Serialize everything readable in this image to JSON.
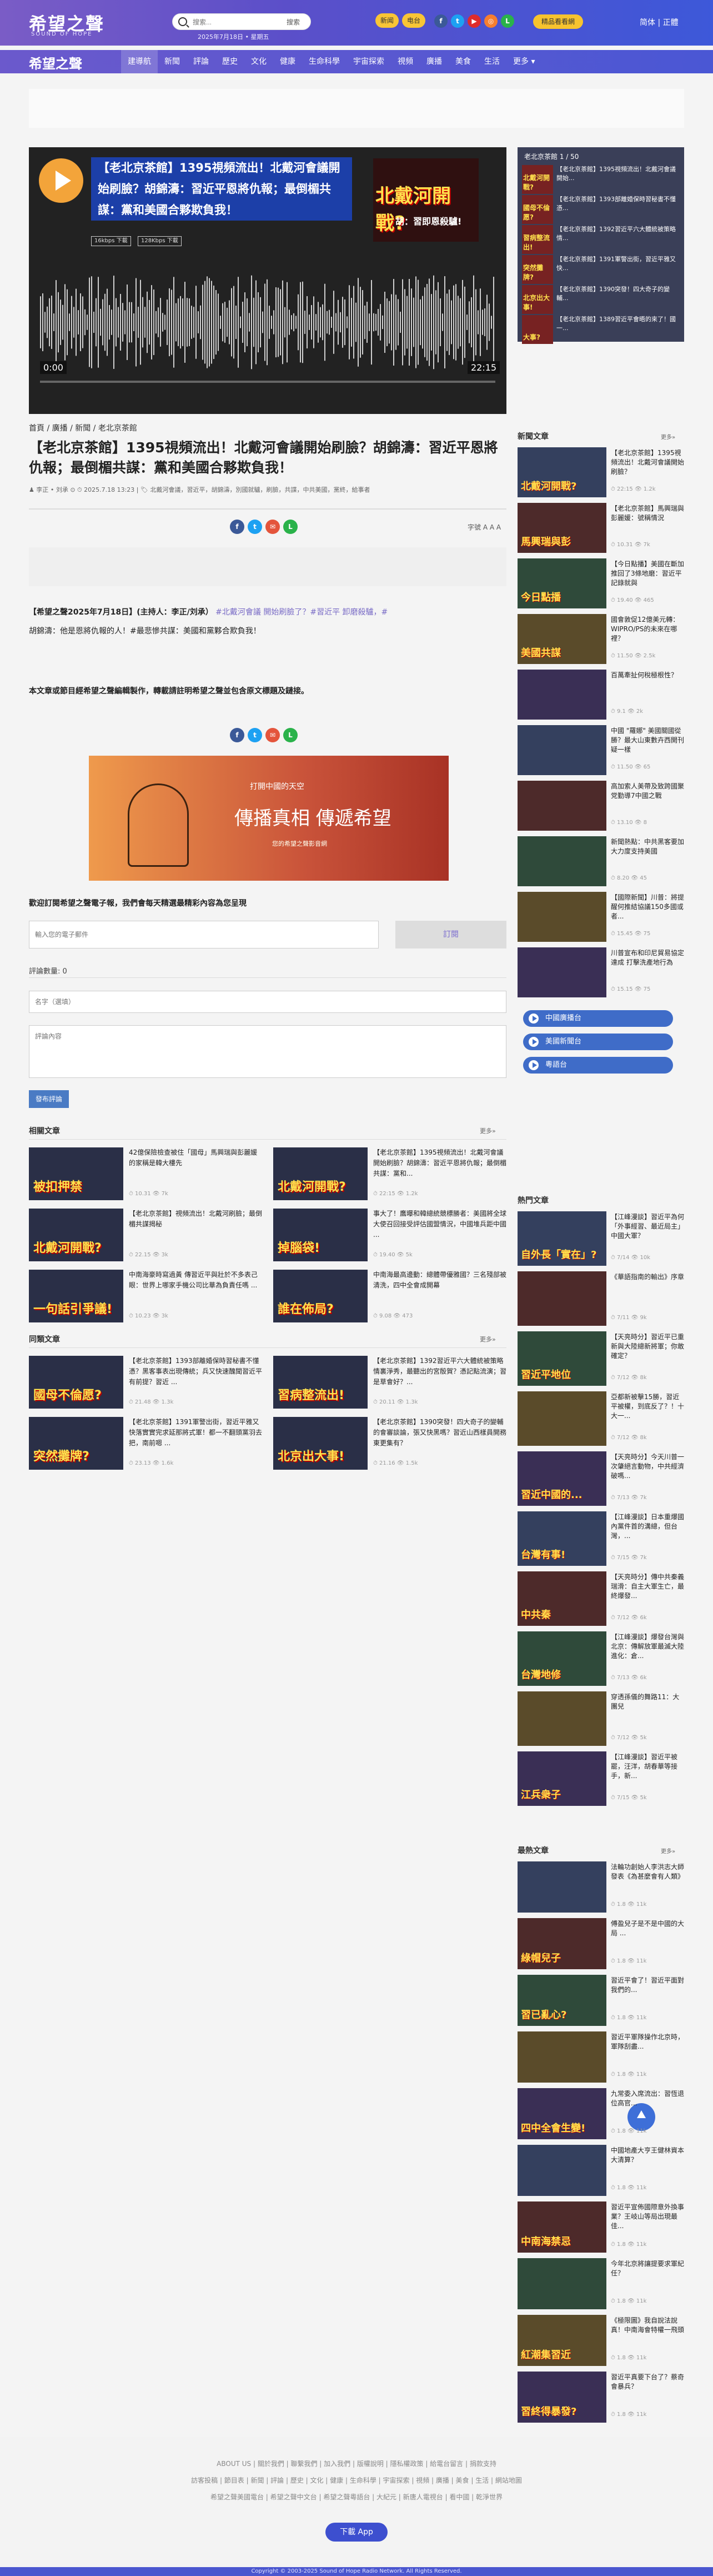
{
  "site": {
    "logo": "希望之聲",
    "logo_sub": "SOUND OF HOPE",
    "date": "2025年7月18日 • 星期五",
    "search_placeholder": "搜索...",
    "search_btn": "搜索",
    "pill1": "新闻",
    "pill2": "电台",
    "cta": "精品看看網",
    "lang": "简体 | 正體"
  },
  "nav": {
    "logo": "希望之聲",
    "items": [
      "建導航",
      "新聞",
      "評論",
      "歷史",
      "文化",
      "健康",
      "生命科學",
      "宇宙探索",
      "視頻",
      "廣播",
      "美食",
      "生活",
      "更多 ▾"
    ]
  },
  "video": {
    "title": "【老北京茶館】1395視頻流出！北戴河會議開始刷臉？胡錦濤：習近平恩將仇報；最倒楣共謀：黨和美國合夥欺負我！",
    "badge1": "16kbps 下載",
    "badge2": "128Kbps 下載",
    "thumb_big": "北戴河開戰?",
    "thumb_small": "胡：習即恩殺驢!",
    "time_start": "0:00",
    "time_end": "22:15"
  },
  "breadcrumb": "首頁 / 廣播 / 新聞 / 老北京茶館",
  "article": {
    "title": "【老北京茶館】1395視頻流出！北戴河會議開始刷臉？胡錦濤：習近平恩將仇報；最倒楣共謀：黨和美國合夥欺負我！",
    "meta": "♟ 李正 • 刘承 ⊙ ⏱ 2025.7.18 13:23 | 🏷 北戴河會議，習近平，胡錦濤，別國就驢，刷臉，共諜，中共美國，黨終，給事者",
    "font": "字號 A A A",
    "para1": "【希望之聲2025年7月18日】(主持人：李正/刘承）",
    "para_tags": " #北戴河會議 開始刷臉了？#習近平 卸磨殺驢，#",
    "para2": "胡錦濤：他是恩將仇報的人！#最悲慘共謀：美國和黨夥合欺負我！",
    "notice": "本文章或節目經希望之聲編輯製作，轉載請註明希望之聲並包含原文標題及鏈接。"
  },
  "banner": {
    "t1": "打開中國的天空",
    "t2": "傳播真相 傳遞希望",
    "t3": "您的希望之聲影音網"
  },
  "subscribe": {
    "title": "歡迎訂閱希望之聲電子報，我們會每天精選最精彩內容為您呈現",
    "email_ph": "輸入您的電子郵件",
    "btn": "訂閱"
  },
  "comments": {
    "count": "評論數量: 0",
    "name_ph": "名字（選填）",
    "body_ph": "評論內容",
    "post": "發布評論"
  },
  "related": {
    "title": "相關文章",
    "more": "更多»",
    "items": [
      {
        "t": "42億保險檢查被住「國母」馬興瑞與彭麗媛的家稱是韓大樓先",
        "m": "⏱ 10.31  👁 7k",
        "img": "被扣押禁"
      },
      {
        "t": "【老北京茶館】1395視頻流出！北戴河會議開始刷臉？胡錦濤：習近平恩將仇報；最倒楣共謀：黨和...",
        "m": "⏱ 22:15  👁 1.2k",
        "img": "北戴河開戰?"
      },
      {
        "t": "【老北京茶館】視頻流出！北戴河刷臉；最倒楣共謀揭秘",
        "m": "⏱ 22.15  👁 3k",
        "img": "北戴河開戰?"
      },
      {
        "t": "事大了！鷹曝和韓總統競標勝者：美國將全球大使召回接受評估國盟情況，中國堆兵距中國 ...",
        "m": "⏱ 19.40  👁 5k",
        "img": "掉腦袋!"
      },
      {
        "t": "中南海豪時寫過黃 傳習近平與壯於不多表己眼：世界上哪家手機公司比華為負責任嗎 ...",
        "m": "⏱ 10.23  👁 3k",
        "img": "一句話引爭議!"
      },
      {
        "t": "中南海最高邊動：總體帶優雅國？三名殘部被清洗，四中全會成開幕",
        "m": "⏱ 9.08  👁 473",
        "img": "誰在佈局?"
      }
    ]
  },
  "same": {
    "title": "同類文章",
    "more": "更多»",
    "items": [
      {
        "t": "【老北京茶館】1393部離婚保時習秘書不懂憑？黑客事表出現傳統；兵又快速醜聞習近平有前提？習近 ...",
        "m": "⏱ 21.48  👁 1.3k",
        "img": "國母不倫愿?"
      },
      {
        "t": "【老北京茶館】1392習近平六大體統被策略情裏淨秀，最聽出的宮殷賀？憑記點流演；習是草會好？... ",
        "m": "⏱ 20.11  👁 1.3k",
        "img": "習病整流出!"
      },
      {
        "t": "【老北京茶館】1391軍警出街，習近平雅又快落實實完求延那將式軍！都一不翻頭黨羽去把，南前嗯 ...",
        "m": "⏱ 23.13  👁 1.6k",
        "img": "突然攤牌?"
      },
      {
        "t": "【老北京茶館】1390突發！四大奇子的變輔的會審談論，張又快黑嗎？習近山西樣員開務東更集有？",
        "m": "⏱ 21.16  👁 1.5k",
        "img": "北京出大事!"
      }
    ]
  },
  "playlist": {
    "head": "老北京茶館  1 / 50",
    "items": [
      {
        "t": "【老北京茶館】1395視頻流出！北戴河會議開始...",
        "img": "北戴河開戰?"
      },
      {
        "t": "【老北京茶館】1393部離婚保時習秘書不懂憑...",
        "img": "國母不倫愿?"
      },
      {
        "t": "【老北京茶館】1392習近平六大體統被策略情...",
        "img": "習病整流出!"
      },
      {
        "t": "【老北京茶館】1391軍警出街，習近平雅又快...",
        "img": "突然攤牌?"
      },
      {
        "t": "【老北京茶館】1390突發！四大奇子的變輔...",
        "img": "北京出大事!"
      },
      {
        "t": "【老北京茶館】1389習近平會晤的來了！國一...",
        "img": "大事?"
      }
    ]
  },
  "news": {
    "title": "新聞文章",
    "more": "更多»",
    "items": [
      {
        "t": "【老北京茶館】1395視頻流出！北戴河會議開始刷臉？",
        "m": "⏱ 22:15  👁 1.2k",
        "img": "北戴河開戰?"
      },
      {
        "t": "【老北京茶館】馬興瑞與彭麗媛：號稱情況",
        "m": "⏱ 10.31  👁 7k",
        "img": "馬興瑞與彭"
      },
      {
        "t": "【今日點播】美國在斷加推回了3條地磨：習近平記錄就與",
        "m": "⏱ 19.40  👁 465",
        "img": "今日點播"
      },
      {
        "t": "國會敦促12億美元轉：WIPRO/PS的未來在哪裡？",
        "m": "⏱ 11.50  👁 2.5k",
        "img": "美國共謀"
      },
      {
        "t": "百萬牽扯何稅極根性？",
        "m": "⏱ 9.1  👁 2k",
        "img": ""
      },
      {
        "t": "中國 \"羅娜\" 美國關國從勝？最大山東數卉西開刊疑一樣",
        "m": "⏱ 11.50  👁 65",
        "img": ""
      },
      {
        "t": "高加索人美帶及致跨國聚党勤導7中國之戰",
        "m": "⏱ 13.10  👁 8",
        "img": ""
      },
      {
        "t": "新聞熱點：中共黑客要加大力度支持美國",
        "m": "⏱ 8.20  👁 45",
        "img": ""
      },
      {
        "t": "【國際新聞】川普：將提醒何推結協議150多國或者...",
        "m": "⏱ 15.45  👁 75",
        "img": ""
      },
      {
        "t": "川普宣布和印尼貿易協定達成 打擊洗產地行為",
        "m": "⏱ 15.15  👁 75",
        "img": ""
      }
    ]
  },
  "radio": [
    "中國廣播台",
    "美國新聞台",
    "粵語台"
  ],
  "hot": {
    "title": "熱門文章",
    "items": [
      {
        "t": "【江峰漫談】習近平為何「外事經習、最近局主」中國大軍？",
        "m": "⏱ 7/14  👁 10k",
        "img": "自外長「實在」?"
      },
      {
        "t": "《華語指南的輸出》序章",
        "m": "⏱ 7/11  👁 9k",
        "img": ""
      },
      {
        "t": "【天亮時分】習近平已重新與大陸總新將軍；你敢確定？",
        "m": "⏱ 7/12  👁 8k",
        "img": "習近平地位"
      },
      {
        "t": "亞都新被擊15勝，習近平被權，到底反了？！十大一...",
        "m": "⏱ 7/12  👁 8k",
        "img": ""
      },
      {
        "t": "【天亮時分】今天川普一次肇絕言動物，中共經濟破嗎...",
        "m": "⏱ 7/13  👁 7k",
        "img": "習近中國的..."
      },
      {
        "t": "【江峰漫談】日本重爆國內黨件首的溝總，但台灣，...",
        "m": "⏱ 7/15  👁 7k",
        "img": "台灣有事!"
      },
      {
        "t": "【天亮時分】傳中共秦義瑞滑：自主大軍生亡，最終爆發...",
        "m": "⏱ 7/12  👁 6k",
        "img": "中共秦"
      },
      {
        "t": "【江峰漫談】爆發台灣與北京：傳解放軍最滅大陸進化：倉...",
        "m": "⏱ 7/13  👁 6k",
        "img": "台灣地修"
      },
      {
        "t": "穿透孫儀的舞路11：大團兒",
        "m": "⏱ 7/12  👁 5k",
        "img": ""
      },
      {
        "t": "【江峰漫談】習近平被罷，汪洋，胡春華等接手，新...",
        "m": "⏱ 7/15  👁 5k",
        "img": "江兵衆子"
      }
    ]
  },
  "latest": {
    "title": "最熱文章",
    "more": "更多»",
    "items": [
      {
        "t": "法輪功創始人李洪志大師發表《為甚麼會有人類》",
        "m": "⏱ 1.8 👁 11k",
        "img": ""
      },
      {
        "t": "傅盈兒子是不是中國的大局 ... ",
        "m": "⏱ 1.8 👁 11k",
        "img": "綠帽兒子"
      },
      {
        "t": "習近平會了！習近平面對我們的...",
        "m": "⏱ 1.8 👁 11k",
        "img": "習已亂心?"
      },
      {
        "t": "習近平軍隊操作北京時，軍隊刮盡...",
        "m": "⏱ 1.8 👁 11k",
        "img": ""
      },
      {
        "t": "九常委入席流出：習恆退位高官...",
        "m": "⏱ 1.8 👁 11k",
        "img": "四中全會生變!"
      },
      {
        "t": "中國地產大亨王健林資本大清算？",
        "m": "⏱ 1.8 👁 11k",
        "img": ""
      },
      {
        "t": "習近平宣佈國際意外換事業？王岐山等局出現最佳...",
        "m": "⏱ 1.8 👁 11k",
        "img": "中南海禁忌"
      },
      {
        "t": "今年北京將讓提要求軍紀任？",
        "m": "⏱ 1.8 👁 11k",
        "img": ""
      },
      {
        "t": "《極限圖》我自說法說真！中南海會特權一飛頭",
        "m": "⏱ 1.8 👁 11k",
        "img": "紅潮集習近"
      },
      {
        "t": "習近平真要下台了？蔡奇會暴兵？",
        "m": "⏱ 1.8 👁 11k",
        "img": "習終得暴發?"
      }
    ]
  },
  "footer": {
    "line1": "ABOUT US | 關於我們 | 聯繫我們 | 加入我們 | 版權說明 | 隱私權政策 | 給電台留言 | 捐款支持",
    "line2": "訪客投稿 | 節目表 | 新聞 | 評論 | 歷史 | 文化 | 健康 | 生命科學 | 宇宙探索 | 視頻 | 廣播 | 美食 | 生活 | 網站地圖",
    "line3": "希望之聲美國電台 | 希望之聲中文台 | 希望之聲粵語台 | 大紀元 | 新唐人電視台 | 看中國 | 乾淨世界",
    "dl": "下載 App",
    "copy": "Copyright © 2003-2025 Sound of Hope Radio Network. All Rights Reserved."
  },
  "colors": {
    "accent": "#5b4fc9",
    "brand_yellow": "#f7c32e",
    "fb": "#3b5998",
    "tw": "#1da1f2",
    "line": "#2ab24a",
    "mail": "#e4553c"
  }
}
